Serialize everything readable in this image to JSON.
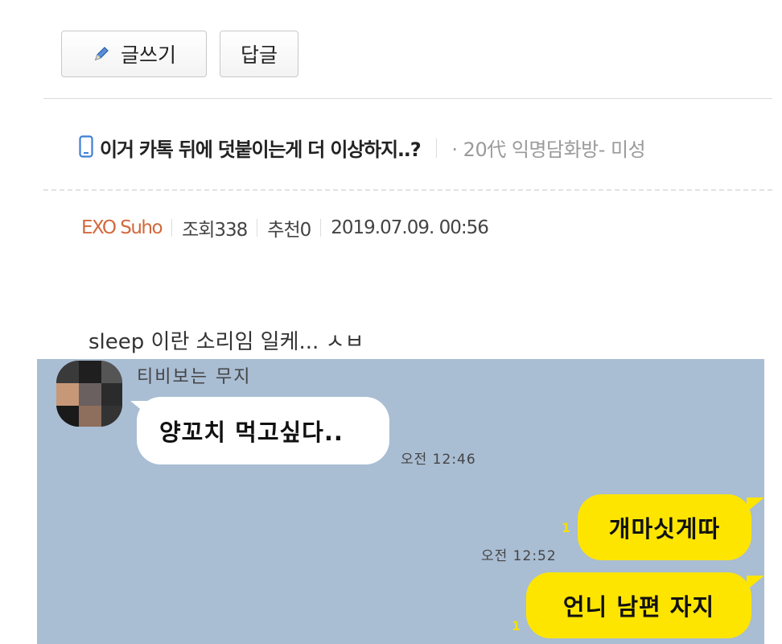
{
  "toolbar": {
    "write_label": "글쓰기",
    "reply_label": "답글"
  },
  "post": {
    "title": "이거 카톡 뒤에 덧붙이는게 더 이상하지..?",
    "board": "· 20代 익명담화방- 미성",
    "author": "EXO Suho",
    "views": "조회338",
    "recommend": "추천0",
    "date": "2019.07.09. 00:56",
    "content_text": "sleep 이란 소리임 일케... ㅅㅂ"
  },
  "chat": {
    "sender_name": "티비보는 무지",
    "messages": [
      {
        "direction": "in",
        "text": "양꼬치 먹고싶다..",
        "time": "오전 12:46"
      },
      {
        "direction": "out",
        "text": "개마싯게따",
        "time": "오전 12:52",
        "unread": "1"
      },
      {
        "direction": "out",
        "text": "언니 남편 자지",
        "unread": "1"
      }
    ]
  },
  "colors": {
    "author": "#d2693c",
    "chat_background": "#a9bdd3",
    "my_bubble": "#fee500",
    "their_bubble": "#ffffff",
    "mobile_icon": "#3d7fd4"
  },
  "icons": [
    "pencil-icon",
    "mobile-icon"
  ]
}
